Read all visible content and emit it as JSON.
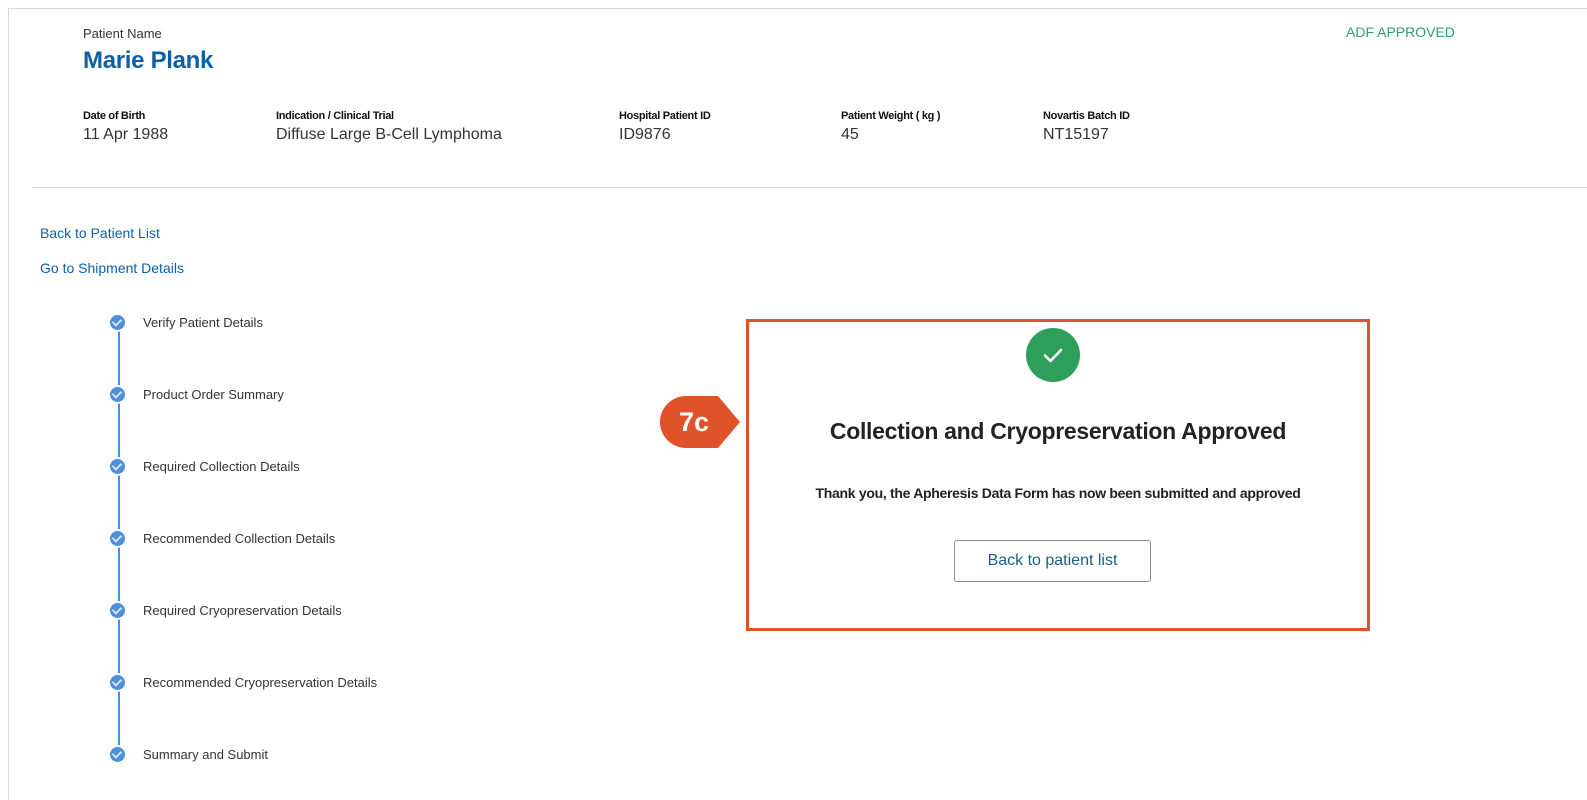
{
  "patient": {
    "name_label": "Patient Name",
    "name": "Marie Plank",
    "status": "ADF APPROVED"
  },
  "fields": [
    {
      "label": "Date of Birth",
      "value": "11 Apr 1988"
    },
    {
      "label": "Indication / Clinical Trial",
      "value": "Diffuse Large B-Cell Lymphoma"
    },
    {
      "label": "Hospital Patient ID",
      "value": "ID9876"
    },
    {
      "label": "Patient Weight ( kg )",
      "value": "45"
    },
    {
      "label": "Novartis Batch ID",
      "value": "NT15197"
    }
  ],
  "nav": {
    "back_to_list": "Back to Patient List",
    "shipment_details": "Go to Shipment Details"
  },
  "steps": [
    {
      "label": "Verify Patient Details"
    },
    {
      "label": "Product Order Summary"
    },
    {
      "label": "Required Collection Details"
    },
    {
      "label": "Recommended Collection Details"
    },
    {
      "label": "Required Cryopreservation Details"
    },
    {
      "label": "Recommended Cryopreservation Details"
    },
    {
      "label": "Summary and Submit"
    }
  ],
  "confirmation": {
    "title": "Collection and Cryopreservation Approved",
    "message": "Thank you, the Apheresis Data Form has now been submitted and approved",
    "button": "Back to patient list"
  },
  "annotation": {
    "label": "7c"
  },
  "colors": {
    "brand_blue": "#0d5fa6",
    "approved_green": "#2e9e6f",
    "check_green": "#2e9e5b",
    "stepper_blue": "#4a90d9",
    "callout_orange": "#e0532a"
  },
  "icons": {
    "step": "check-dot-icon",
    "success": "checkmark-circle-icon"
  }
}
